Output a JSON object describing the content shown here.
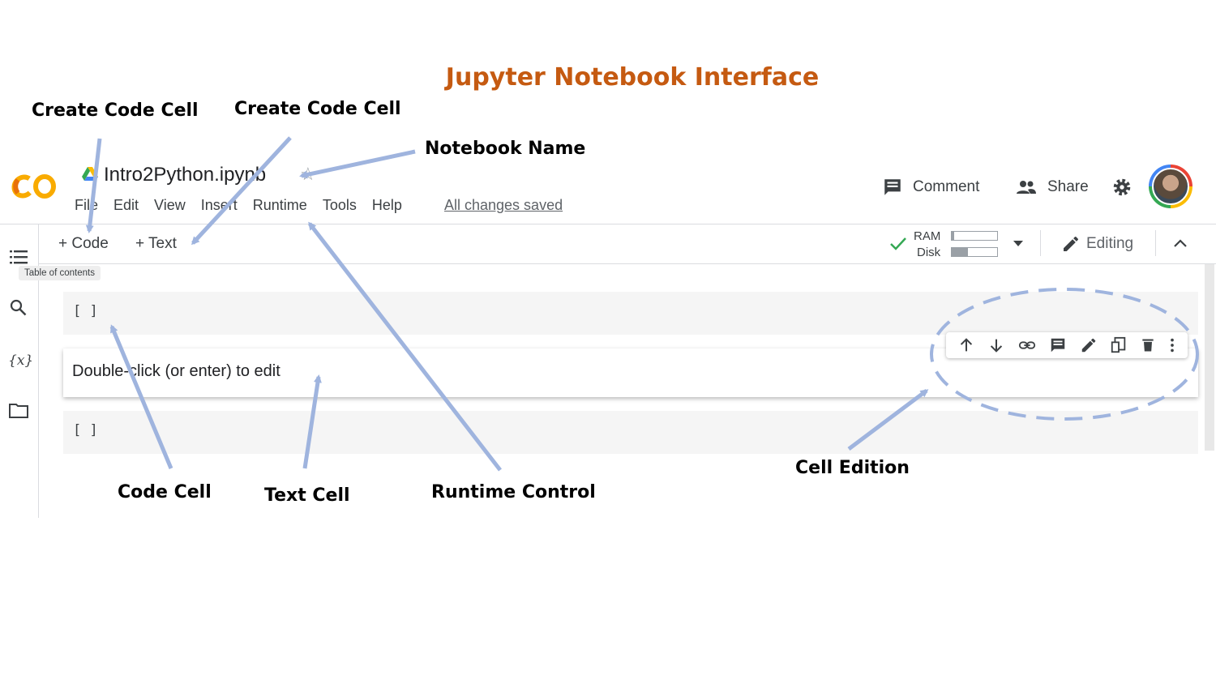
{
  "title": "Jupyter Notebook Interface",
  "annotations": {
    "create_code_cell_1": "Create Code Cell",
    "create_code_cell_2": "Create Code Cell",
    "notebook_name": "Notebook Name",
    "code_cell": "Code Cell",
    "text_cell": "Text Cell",
    "runtime_control": "Runtime Control",
    "cell_edition": "Cell Edition"
  },
  "colab": {
    "logo_text": "CO",
    "notebook_name": "Intro2Python.ipynb",
    "menu": [
      "File",
      "Edit",
      "View",
      "Insert",
      "Runtime",
      "Tools",
      "Help"
    ],
    "save_status": "All changes saved",
    "header_actions": {
      "comment": "Comment",
      "share": "Share"
    },
    "toolbar": {
      "add_code": "+ Code",
      "add_text": "+ Text",
      "ram_label": "RAM",
      "disk_label": "Disk",
      "editing": "Editing"
    },
    "resources": {
      "ram_fraction": 0.05,
      "disk_fraction": 0.35
    },
    "sidebar_tooltip": "Table of contents",
    "cells": {
      "code_cell_1_prompt": "[ ]",
      "text_cell_placeholder": "Double-click (or enter) to edit",
      "code_cell_2_prompt": "[ ]"
    },
    "cell_toolbar_icons": [
      "arrow-up-icon",
      "arrow-down-icon",
      "link-icon",
      "comment-icon",
      "edit-icon",
      "mirror-cell-icon",
      "delete-icon",
      "more-vert-icon"
    ],
    "colors": {
      "logo_orange": "#f9ab00",
      "annotation_arrow": "#9fb4de",
      "title": "#c55a11",
      "check_green": "#34a853"
    }
  }
}
